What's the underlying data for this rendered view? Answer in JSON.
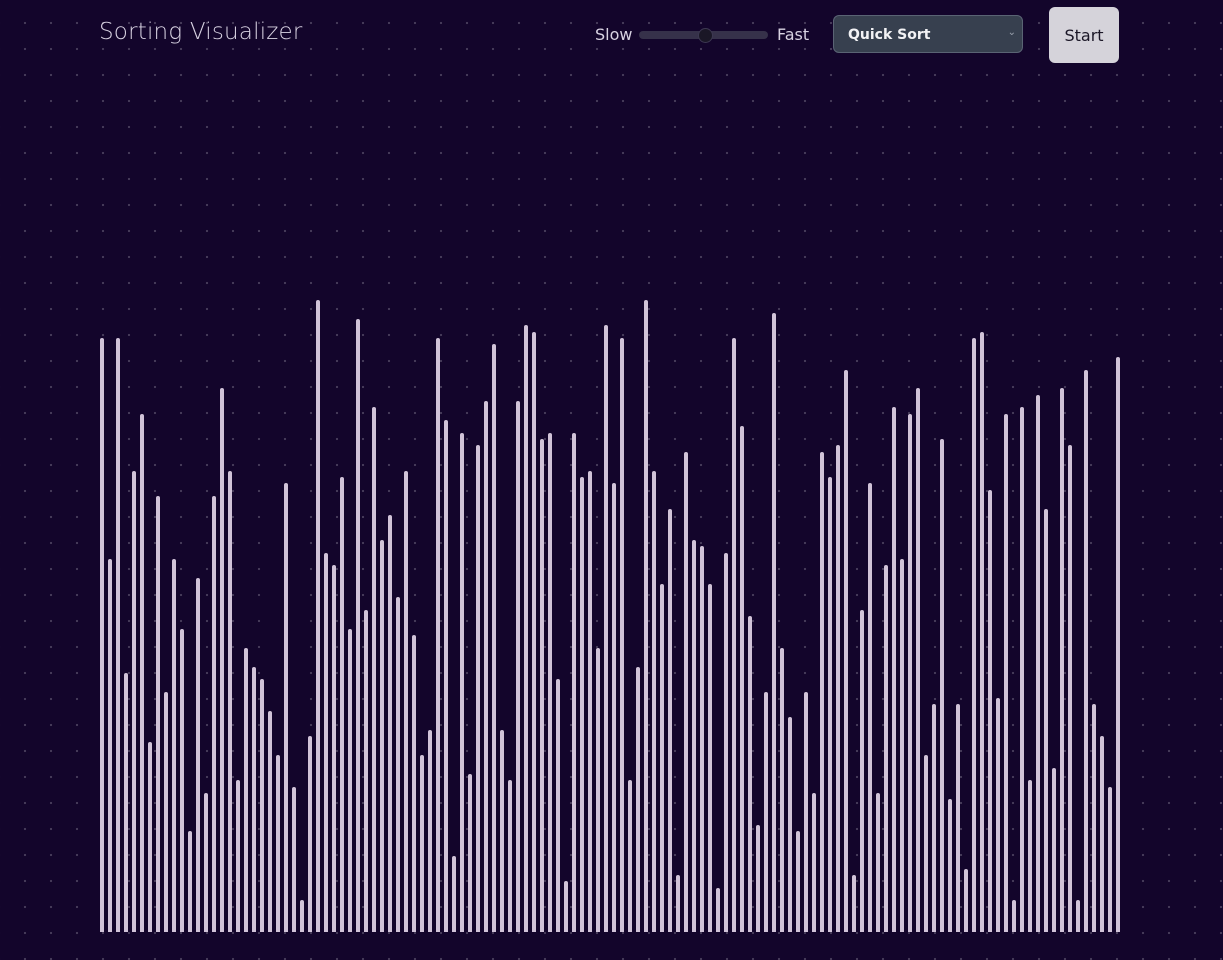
{
  "header": {
    "title": "Sorting Visualizer"
  },
  "speed": {
    "slow_label": "Slow",
    "fast_label": "Fast",
    "value": 0.5
  },
  "algorithm": {
    "selected": "Quick Sort"
  },
  "controls": {
    "start_label": "Start"
  },
  "colors": {
    "background": "#13052b",
    "bar": "#d1c3d8"
  },
  "chart_data": {
    "type": "bar",
    "values": [
      94,
      59,
      94,
      41,
      73,
      82,
      30,
      69,
      38,
      59,
      48,
      16,
      56,
      22,
      69,
      86,
      73,
      24,
      45,
      42,
      40,
      35,
      28,
      71,
      23,
      5,
      31,
      100,
      60,
      58,
      72,
      48,
      97,
      51,
      83,
      62,
      66,
      53,
      73,
      47,
      28,
      32,
      94,
      81,
      12,
      79,
      25,
      77,
      84,
      93,
      32,
      24,
      84,
      96,
      95,
      78,
      79,
      40,
      8,
      79,
      72,
      73,
      45,
      96,
      71,
      94,
      24,
      42,
      100,
      73,
      55,
      67,
      9,
      76,
      62,
      61,
      55,
      7,
      60,
      94,
      80,
      50,
      17,
      38,
      98,
      45,
      34,
      16,
      38,
      22,
      76,
      72,
      77,
      89,
      9,
      51,
      71,
      22,
      58,
      83,
      59,
      82,
      86,
      28,
      36,
      78,
      21,
      36,
      10,
      94,
      95,
      70,
      37,
      82,
      5,
      83,
      24,
      85,
      67,
      26,
      86,
      77,
      5,
      89,
      36,
      31,
      23,
      91
    ]
  }
}
